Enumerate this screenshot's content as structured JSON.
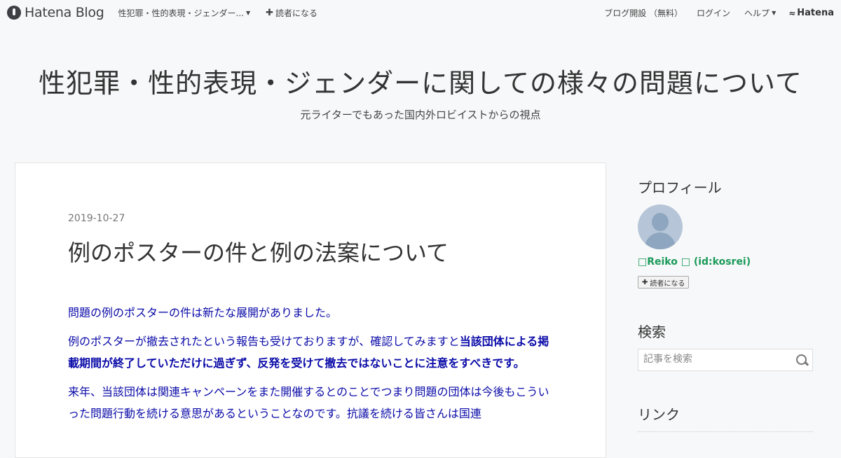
{
  "global_header": {
    "logo_text": "Hatena Blog",
    "blog_name": "性犯罪・性的表現・ジェンダー...",
    "subscribe_label": "読者になる",
    "register_label": "ブログ開設 （無料）",
    "login_label": "ログイン",
    "help_label": "ヘルプ",
    "brand_label": "Hatena"
  },
  "blog": {
    "title": "性犯罪・性的表現・ジェンダーに関しての様々の問題について",
    "description": "元ライターでもあった国内外ロビイストからの視点"
  },
  "entry": {
    "date": "2019-10-27",
    "title": "例のポスターの件と例の法案について",
    "p1": "問題の例のポスターの件は新たな展開がありました。",
    "p2_plain": "例のポスターが撤去されたという報告も受けておりますが、確認してみますと",
    "p2_bold": "当該団体による掲載期間が終了していただけに過ぎず、反発を受けて撤去ではないことに注意をすべきです。",
    "p3": "来年、当該団体は関連キャンペーンをまた開催するとのことでつまり問題の団体は今後もこういった問題行動を続ける意思があるということなのです。抗議を続ける皆さんは国連"
  },
  "sidebar": {
    "profile_title": "プロフィール",
    "profile_name": "□Reiko □ (id:kosrei)",
    "subscribe_label": "読者になる",
    "search_title": "検索",
    "search_placeholder": "記事を検索",
    "links_title": "リンク"
  },
  "colors": {
    "body_text": "#0a0aa8",
    "profile_name": "#1a9a5a"
  }
}
